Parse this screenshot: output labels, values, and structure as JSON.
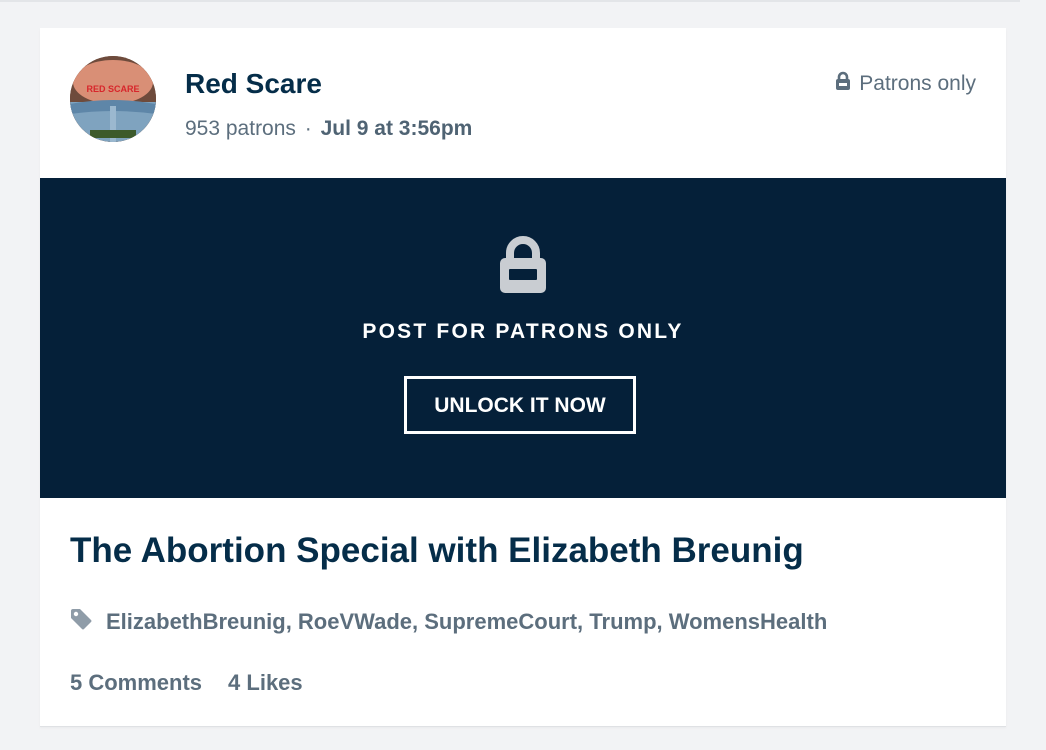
{
  "post": {
    "creator_name": "Red Scare",
    "patron_count": "953 patrons",
    "separator": "·",
    "date": "Jul 9 at 3:56pm",
    "privacy_label": "Patrons only",
    "avatar_text": "RED SCARE",
    "locked_message": "POST FOR PATRONS ONLY",
    "unlock_label": "UNLOCK IT NOW",
    "title": "The Abortion Special with Elizabeth Breunig",
    "tags": [
      "ElizabethBreunig",
      "RoeVWade",
      "SupremeCourt",
      "Trump",
      "WomensHealth"
    ],
    "comments_label": "5 Comments",
    "likes_label": "4 Likes"
  },
  "icons": {
    "privacy": "lock-icon",
    "locked_panel": "lock-icon",
    "tags": "tag-icon"
  },
  "colors": {
    "page_background": "#f2f3f5",
    "card_background": "#ffffff",
    "locked_panel_background": "#052039",
    "title_text": "#052d49",
    "muted_text": "#5c6e7d",
    "lock_icon_gray": "#c9cdd2"
  }
}
